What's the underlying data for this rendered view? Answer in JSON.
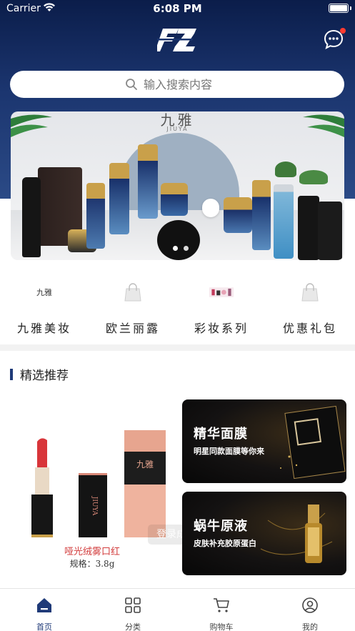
{
  "status_bar": {
    "carrier": "Carrier",
    "time": "6:08 PM"
  },
  "header": {
    "logo_text": "FZ",
    "message_icon": "chat-bubble-icon",
    "has_unread": true
  },
  "search": {
    "placeholder": "输入搜索内容"
  },
  "banner": {
    "brand": "九雅",
    "brand_sub": "JIUYA",
    "slide_count": 2,
    "active_slide": 0
  },
  "categories": [
    {
      "label": "九雅美妆",
      "icon": "jiuya-logo-thumb"
    },
    {
      "label": "欧兰丽露",
      "icon": "shopping-bag-icon"
    },
    {
      "label": "彩妆系列",
      "icon": "cosmetics-thumb"
    },
    {
      "label": "优惠礼包",
      "icon": "shopping-bag-icon"
    }
  ],
  "section": {
    "title": "精选推荐"
  },
  "featured": {
    "main": {
      "title": "哑光绒雾口红",
      "spec": "规格：3.8g",
      "box_brand": "九雅",
      "side_text": "JIUYA"
    },
    "cards": [
      {
        "title": "精华面膜",
        "subtitle": "明星同款面膜等你来"
      },
      {
        "title": "蜗牛原液",
        "subtitle": "皮肤补充胶原蛋白"
      }
    ]
  },
  "toast": {
    "text": "登录成功"
  },
  "tabbar": [
    {
      "label": "首页",
      "icon": "home-icon",
      "active": true
    },
    {
      "label": "分类",
      "icon": "grid-icon",
      "active": false
    },
    {
      "label": "购物车",
      "icon": "cart-icon",
      "active": false
    },
    {
      "label": "我的",
      "icon": "profile-icon",
      "active": false
    }
  ],
  "colors": {
    "brand_navy": "#1f3a78",
    "header_top": "#0b1d4a",
    "unread_dot": "#ff3b30",
    "promo_red": "#d23b3b"
  }
}
